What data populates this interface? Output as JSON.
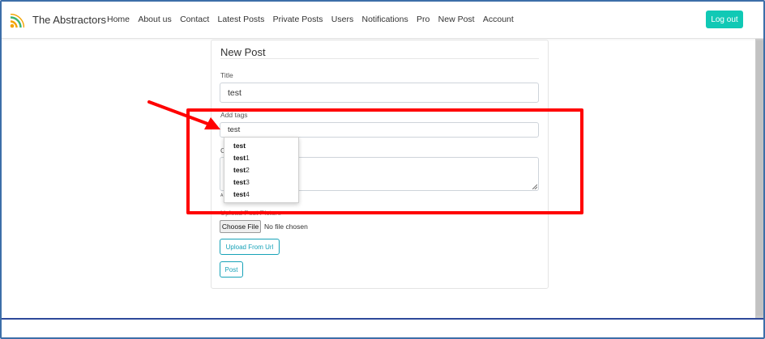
{
  "navbar": {
    "brand": "The Abstractors",
    "links": [
      "Home",
      "About us",
      "Contact",
      "Latest Posts",
      "Private Posts",
      "Users",
      "Notifications",
      "Pro",
      "New Post",
      "Account"
    ],
    "logout_label": "Log out"
  },
  "form": {
    "heading": "New Post",
    "title_label": "Title",
    "title_value": "test",
    "tags_label": "Add tags",
    "tags_value": "test",
    "content_label_partial": "C",
    "hint_partial": "A",
    "upload_label_partial": "Upload Post Picture",
    "choose_file_label": "Choose File",
    "no_file_text": "No file chosen",
    "upload_url_label": "Upload From Url",
    "post_label": "Post"
  },
  "autocomplete": {
    "match": "test",
    "items": [
      {
        "match": "test",
        "rest": ""
      },
      {
        "match": "test",
        "rest": "1"
      },
      {
        "match": "test",
        "rest": "2"
      },
      {
        "match": "test",
        "rest": "3"
      },
      {
        "match": "test",
        "rest": "4"
      }
    ]
  },
  "colors": {
    "accent": "#10c9b5",
    "outline_button": "#17a2b8",
    "annotation": "#ff0000",
    "frame": "#3d6ea8"
  },
  "icons": {
    "brand": "rss-feed-icon",
    "annotation_arrow": "red-arrow-icon"
  }
}
